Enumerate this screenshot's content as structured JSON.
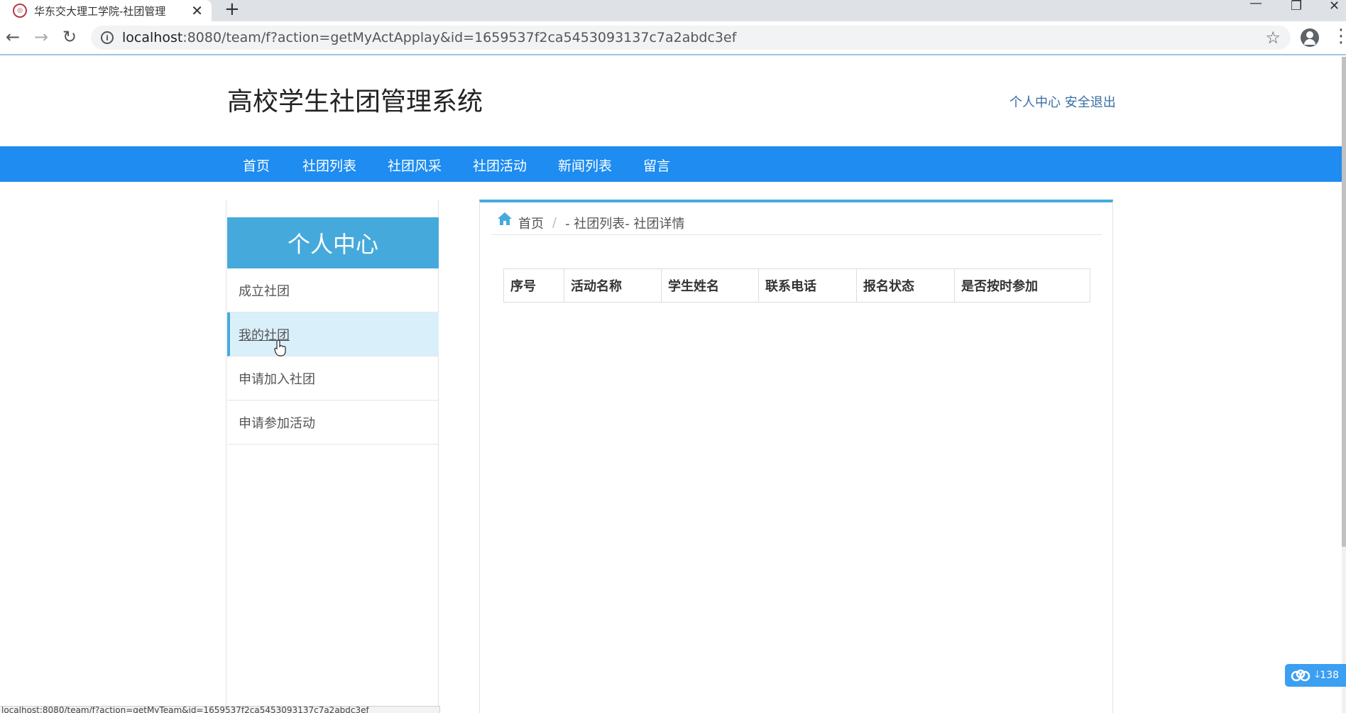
{
  "browser": {
    "tab_title": "华东交大理工学院-社团管理",
    "tab_close": "✕",
    "new_tab": "+",
    "window_controls": {
      "minimize": "—",
      "restore": "❐",
      "close": "✕"
    },
    "nav": {
      "back": "←",
      "forward": "→",
      "reload": "↻"
    },
    "url_host": "localhost",
    "url_rest": ":8080/team/f?action=getMyActApplay&id=1659537f2ca5453093137c7a2abdc3ef",
    "status_url": "localhost:8080/team/f?action=getMyTeam&id=1659537f2ca5453093137c7a2abdc3ef"
  },
  "header": {
    "site_title": "高校学生社团管理系统",
    "personal_center": "个人中心",
    "logout": "安全退出"
  },
  "nav": {
    "items": [
      "首页",
      "社团列表",
      "社团风采",
      "社团活动",
      "新闻列表",
      "留言"
    ]
  },
  "sidebar": {
    "title": "个人中心",
    "items": [
      "成立社团",
      "我的社团",
      "申请加入社团",
      "申请参加活动"
    ],
    "active_index": 1
  },
  "breadcrumb": {
    "home": "首页",
    "separator": "/",
    "trail": "- 社团列表- 社团详情"
  },
  "table": {
    "columns": [
      "序号",
      "活动名称",
      "学生姓名",
      "联系电话",
      "报名状态",
      "是否按时参加"
    ],
    "rows": []
  },
  "widget": {
    "count": "138",
    "arrow": "🡓"
  },
  "colors": {
    "nav_bg": "#1e8cf0",
    "accent": "#45aadb",
    "active_item_bg": "#d9f0fb",
    "link": "#3a6ea5"
  },
  "icons": [
    "home-icon",
    "cloud-icon",
    "star-icon",
    "info-icon",
    "cursor-icon"
  ]
}
